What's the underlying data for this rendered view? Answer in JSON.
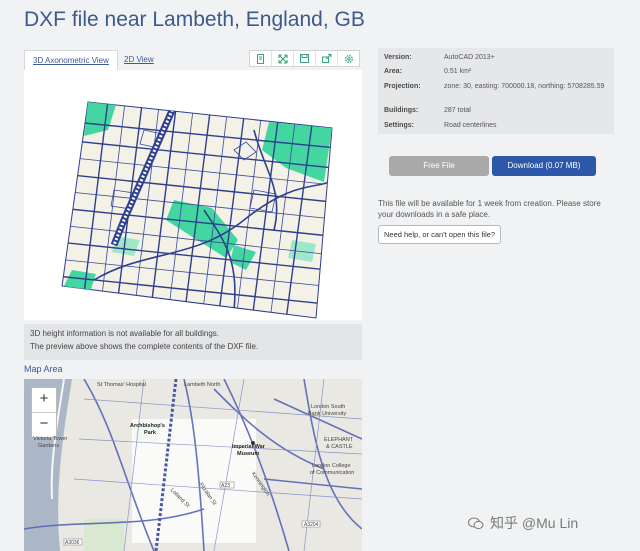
{
  "title": "DXF file near Lambeth, England, GB",
  "tabs": [
    {
      "label": "3D Axonometric View"
    },
    {
      "label": "2D View"
    }
  ],
  "toolbar_icons": [
    "page-icon",
    "expand-icon",
    "save-icon",
    "share-icon",
    "settings-icon"
  ],
  "specs": {
    "version": {
      "key": "Version:",
      "value": "AutoCAD 2013+"
    },
    "area": {
      "key": "Area:",
      "value": "0.51 km²"
    },
    "projection": {
      "key": "Projection:",
      "value": "zone: 30, easting: 700000.18, northing: 5708285.59"
    },
    "buildings": {
      "key": "Buildings:",
      "value": "287 total"
    },
    "settings": {
      "key": "Settings:",
      "value": "Road centerlines"
    }
  },
  "buttons": {
    "free": "Free File",
    "download": "Download (0.07 MB)"
  },
  "availability_note": "This file will be available for 1 week from creation. Please store your downloads in a safe place.",
  "help_button": "Need help, or can't open this file?",
  "preview_note": {
    "line1": "3D height information is not available for all buildings.",
    "line2": "The preview above shows the complete contents of the DXF file."
  },
  "map_area_label": "Map Area",
  "map": {
    "zoom_in": "+",
    "zoom_out": "−",
    "labels": {
      "st_thomas": "St Thomas' Hospital",
      "lambeth_north": "Lambeth North",
      "london_south_bank": "London South",
      "bank_university": "Bank University",
      "archbishops": "Archbishop's",
      "park": "Park",
      "imperial_war": "Imperial War",
      "museum": "Museum",
      "victoria_tower": "Victoria Tower",
      "gardens": "Gardens",
      "elephant": "ELEPHANT",
      "castle": "& CASTLE",
      "london_college": "London College",
      "of_communication": "of Communication",
      "a23": "A23",
      "a3036": "A3036",
      "a3204": "A3204",
      "fitzalan_st": "Fitzalan St",
      "lolland_st": "Lolland St",
      "kennington": "Kennington"
    }
  },
  "watermark": "知乎 @Mu Lin",
  "colors": {
    "title": "#3d5a8a",
    "road": "#2f3f8f",
    "green": "#43d6a1",
    "download": "#2d57a8",
    "free": "#a9a9a9"
  }
}
